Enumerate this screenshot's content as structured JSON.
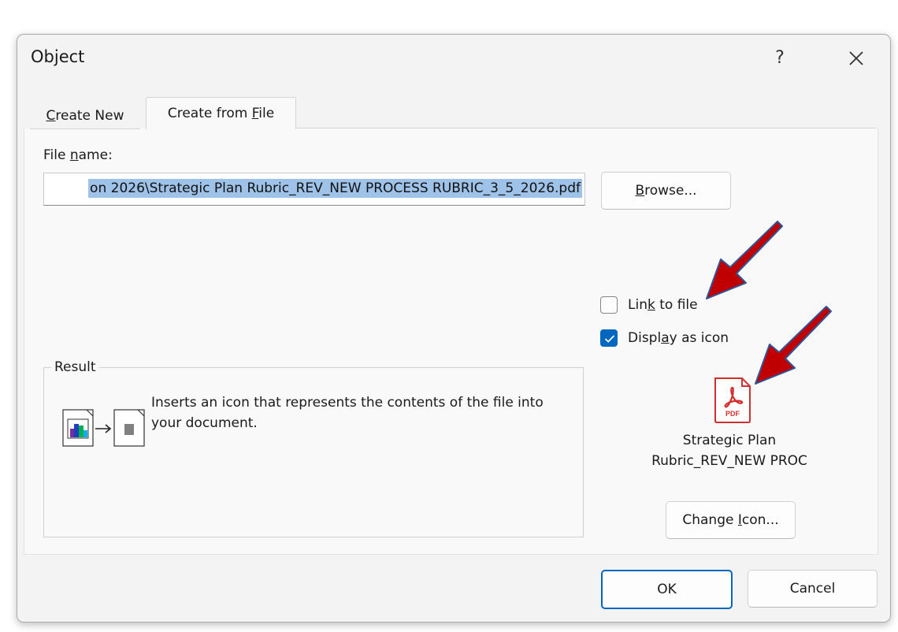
{
  "dialog": {
    "title": "Object",
    "help_symbol": "?",
    "close_icon": "close-icon"
  },
  "tabs": [
    {
      "label_pre": "",
      "label_key": "C",
      "label_post": "reate New",
      "active": false
    },
    {
      "label_pre": "Create from ",
      "label_key": "F",
      "label_post": "ile",
      "active": true
    }
  ],
  "file": {
    "label_pre": "File ",
    "label_key": "n",
    "label_post": "ame:",
    "value": "on 2026\\Strategic Plan Rubric_REV_NEW PROCESS RUBRIC_3_5_2026.pdf"
  },
  "buttons": {
    "browse_key": "B",
    "browse_post": "rowse...",
    "change_icon_pre": "Change ",
    "change_icon_key": "I",
    "change_icon_post": "con...",
    "ok": "OK",
    "cancel": "Cancel"
  },
  "options": {
    "link_pre": "Lin",
    "link_key": "k",
    "link_post": " to file",
    "link_checked": false,
    "display_pre": "Displ",
    "display_key": "a",
    "display_post": "y as icon",
    "display_checked": true
  },
  "result": {
    "label": "Result",
    "description": "Inserts an icon that represents the contents of the file into your document."
  },
  "icon_preview": {
    "badge": "PDF",
    "caption_line1": "Strategic Plan",
    "caption_line2": "Rubric_REV_NEW PROC"
  },
  "colors": {
    "accent": "#0067c0",
    "selection": "#9fc3e8",
    "annotation_arrow": "#c00000",
    "pdf_red": "#d32f2f"
  }
}
